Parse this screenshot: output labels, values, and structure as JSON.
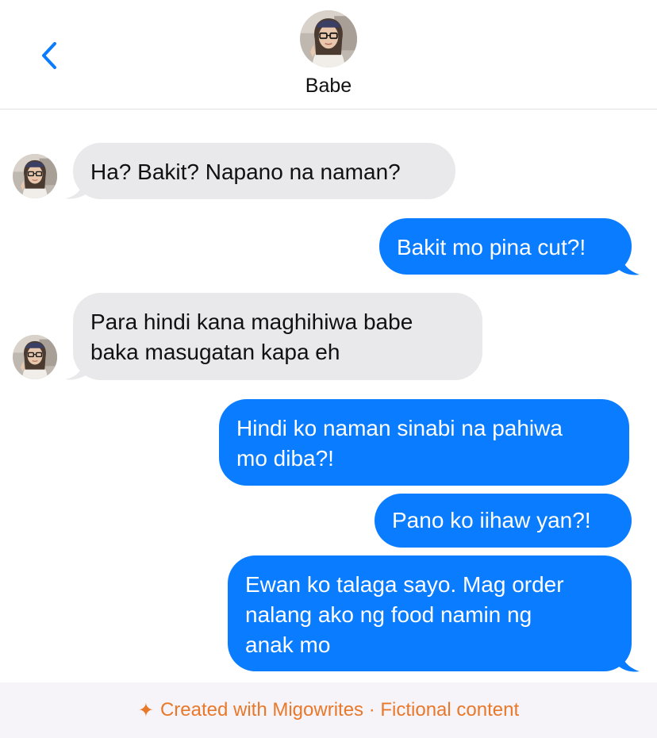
{
  "header": {
    "contact_name": "Babe",
    "back_icon": "chevron-left-icon"
  },
  "colors": {
    "outgoing_bubble": "#0a7cff",
    "incoming_bubble": "#e9e9eb",
    "accent": "#0a7cff",
    "footer_text": "#e8782a"
  },
  "messages": [
    {
      "sender": "contact",
      "lines": [
        "Ha? Bakit? Napano na naman?"
      ]
    },
    {
      "sender": "me",
      "lines": [
        "Bakit mo pina cut?!"
      ]
    },
    {
      "sender": "contact",
      "lines": [
        "Para hindi kana maghihiwa babe",
        "baka masugatan kapa eh"
      ]
    },
    {
      "sender": "me",
      "lines": [
        "Hindi ko naman sinabi na pahiwa",
        "mo diba?!"
      ]
    },
    {
      "sender": "me",
      "lines": [
        "Pano ko iihaw yan?!"
      ]
    },
    {
      "sender": "me",
      "lines": [
        "Ewan ko talaga sayo. Mag order",
        "nalang ako ng food namin ng",
        "anak mo"
      ]
    }
  ],
  "footer": {
    "spark": "✦",
    "text": "Created with Migowrites · Fictional content"
  }
}
